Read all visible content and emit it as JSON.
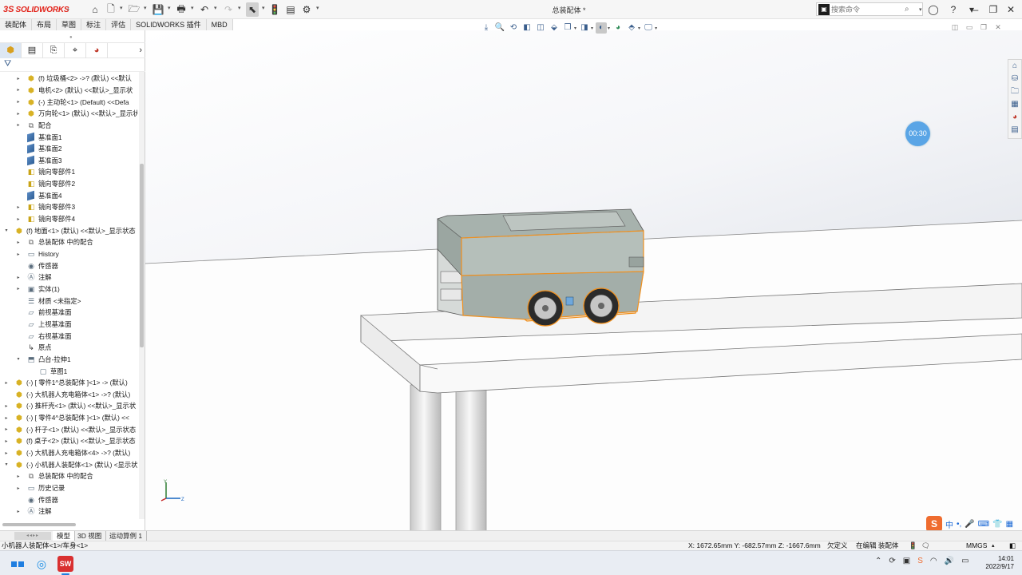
{
  "app": {
    "logo_ds": "3S",
    "logo_name": "SOLIDWORKS",
    "document_title": "总装配体 *",
    "search_placeholder": "搜索命令"
  },
  "command_tabs": [
    "装配体",
    "布局",
    "草图",
    "标注",
    "评估",
    "SOLIDWORKS 插件",
    "MBD"
  ],
  "feature_tree": [
    {
      "label": "(f) 垃圾桶<2> ->? (默认) <<默认",
      "icon": "component-icon",
      "level": 1,
      "expander": "collapsed"
    },
    {
      "label": "电机<2> (默认) <<默认>_显示状",
      "icon": "component-icon",
      "level": 1,
      "expander": "collapsed"
    },
    {
      "label": "(-) 主动轮<1> (Default) <<Defa",
      "icon": "component-icon",
      "level": 1,
      "expander": "collapsed"
    },
    {
      "label": "万向轮<1> (默认) <<默认>_显示状",
      "icon": "component-icon",
      "level": 1,
      "expander": "collapsed"
    },
    {
      "label": "配合",
      "icon": "mates-icon",
      "level": 1,
      "expander": "collapsed"
    },
    {
      "label": "基准面1",
      "icon": "plane-icon",
      "level": 1,
      "expander": "none"
    },
    {
      "label": "基准面2",
      "icon": "plane-icon",
      "level": 1,
      "expander": "none"
    },
    {
      "label": "基准面3",
      "icon": "plane-icon",
      "level": 1,
      "expander": "none"
    },
    {
      "label": "镜向零部件1",
      "icon": "mirror-component-icon",
      "level": 1,
      "expander": "none"
    },
    {
      "label": "镜向零部件2",
      "icon": "mirror-component-icon",
      "level": 1,
      "expander": "none"
    },
    {
      "label": "基准面4",
      "icon": "plane-icon",
      "level": 1,
      "expander": "none"
    },
    {
      "label": "镜向零部件3",
      "icon": "mirror-component-icon",
      "level": 1,
      "expander": "collapsed"
    },
    {
      "label": "镜向零部件4",
      "icon": "mirror-component-icon",
      "level": 1,
      "expander": "collapsed"
    },
    {
      "label": "(f) 地面<1> (默认) <<默认>_显示状态",
      "icon": "component-icon",
      "level": 0,
      "expander": "expanded"
    },
    {
      "label": "总装配体 中的配合",
      "icon": "mates-icon",
      "level": 1,
      "expander": "collapsed"
    },
    {
      "label": "History",
      "icon": "history-icon",
      "level": 1,
      "expander": "collapsed"
    },
    {
      "label": "传感器",
      "icon": "sensor-icon",
      "level": 1,
      "expander": "none"
    },
    {
      "label": "注解",
      "icon": "annotation-icon",
      "level": 1,
      "expander": "collapsed"
    },
    {
      "label": "实体(1)",
      "icon": "solid-bodies-icon",
      "level": 1,
      "expander": "collapsed"
    },
    {
      "label": "材质 <未指定>",
      "icon": "material-icon",
      "level": 1,
      "expander": "none"
    },
    {
      "label": "前视基准面",
      "icon": "ref-plane-icon",
      "level": 1,
      "expander": "none"
    },
    {
      "label": "上视基准面",
      "icon": "ref-plane-icon",
      "level": 1,
      "expander": "none"
    },
    {
      "label": "右视基准面",
      "icon": "ref-plane-icon",
      "level": 1,
      "expander": "none"
    },
    {
      "label": "原点",
      "icon": "origin-icon",
      "level": 1,
      "expander": "none"
    },
    {
      "label": "凸台-拉伸1",
      "icon": "extrude-icon",
      "level": 1,
      "expander": "expanded"
    },
    {
      "label": "草图1",
      "icon": "sketch-icon",
      "level": 2,
      "expander": "none"
    },
    {
      "label": "(-) [ 零件1^总装配体 ]<1> -> (默认)",
      "icon": "component-icon",
      "level": 0,
      "expander": "collapsed"
    },
    {
      "label": "(-) 大机器人充电箱体<1> ->? (默认)",
      "icon": "component-icon",
      "level": 0,
      "expander": "none"
    },
    {
      "label": "(-) 推杆壳<1> (默认) <<默认>_显示状",
      "icon": "component-icon",
      "level": 0,
      "expander": "collapsed"
    },
    {
      "label": "(-) [ 零件4^总装配体 ]<1> (默认) <<",
      "icon": "component-icon",
      "level": 0,
      "expander": "collapsed"
    },
    {
      "label": "(-) 杆子<1> (默认) <<默认>_显示状态",
      "icon": "component-icon",
      "level": 0,
      "expander": "collapsed"
    },
    {
      "label": "(f) 桌子<2> (默认) <<默认>_显示状态",
      "icon": "component-icon",
      "level": 0,
      "expander": "collapsed"
    },
    {
      "label": "(-) 大机器人充电箱体<4> ->? (默认)",
      "icon": "component-icon",
      "level": 0,
      "expander": "collapsed"
    },
    {
      "label": "(-) 小机器人装配体<1> (默认) <显示状",
      "icon": "subassembly-icon",
      "level": 0,
      "expander": "expanded"
    },
    {
      "label": "总装配体 中的配合",
      "icon": "mates-icon",
      "level": 1,
      "expander": "collapsed"
    },
    {
      "label": "历史记录",
      "icon": "history-icon",
      "level": 1,
      "expander": "collapsed"
    },
    {
      "label": "传感器",
      "icon": "sensor-icon",
      "level": 1,
      "expander": "none"
    },
    {
      "label": "注解",
      "icon": "annotation-icon",
      "level": 1,
      "expander": "collapsed"
    }
  ],
  "viewport": {
    "timer": "00:30",
    "ime_label": "中"
  },
  "bottom_tabs": [
    "模型",
    "3D 视图",
    "运动算例 1"
  ],
  "status": {
    "selection": "小机器人装配体<1>/车身<1>",
    "coords": "X: 1672.65mm Y: -682.57mm Z: -1667.6mm",
    "definition": "欠定义",
    "editing": "在编辑 装配体",
    "units": "MMGS"
  },
  "clock": {
    "time": "14:01",
    "date": "2022/9/17"
  },
  "colors": {
    "accent": "#e2231a",
    "selection_orange": "#f0901e",
    "robot_body": "#a7b2ad",
    "timer_blue": "#5aa5e6"
  }
}
